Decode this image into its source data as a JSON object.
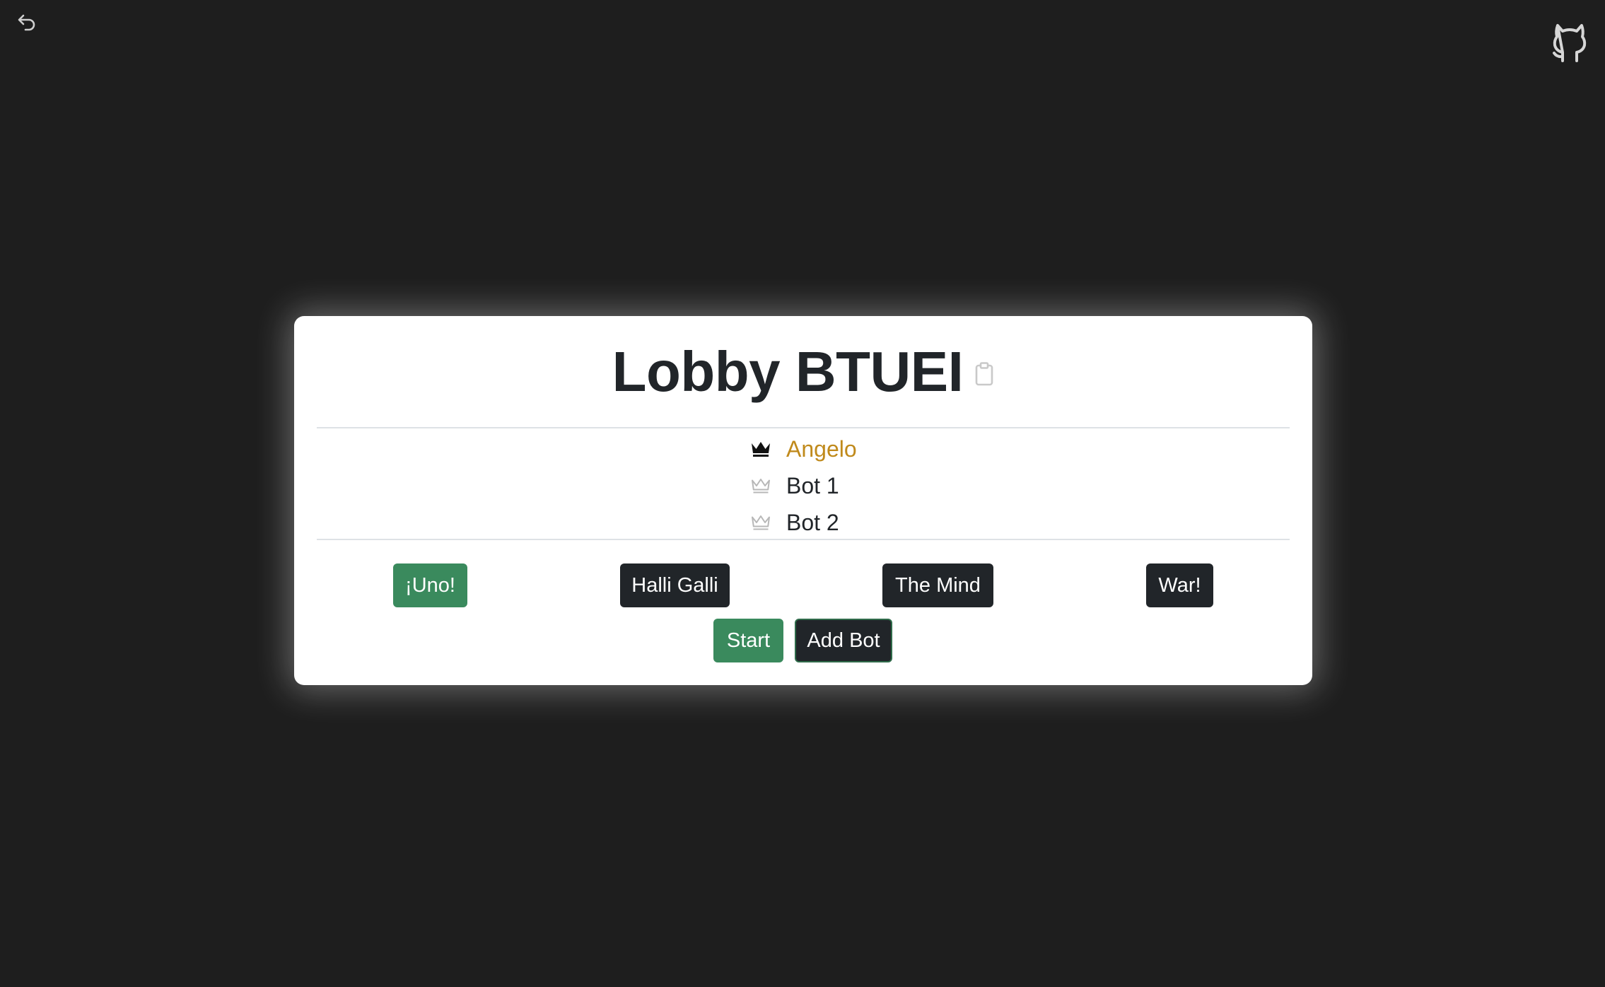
{
  "nav": {
    "back_icon": "undo-arrow-icon",
    "github_icon": "github-octocat-icon"
  },
  "lobby": {
    "title": "Lobby BTUEI",
    "copy_icon": "clipboard-icon"
  },
  "players": [
    {
      "name": "Angelo",
      "host": true,
      "icon": "crown-filled-icon"
    },
    {
      "name": "Bot 1",
      "host": false,
      "icon": "crown-outline-icon"
    },
    {
      "name": "Bot 2",
      "host": false,
      "icon": "crown-outline-icon"
    }
  ],
  "games": [
    {
      "label": "¡Uno!",
      "selected": true
    },
    {
      "label": "Halli Galli",
      "selected": false
    },
    {
      "label": "The Mind",
      "selected": false
    },
    {
      "label": "War!",
      "selected": false
    }
  ],
  "actions": {
    "start_label": "Start",
    "add_bot_label": "Add Bot"
  },
  "colors": {
    "background": "#1e1e1e",
    "card": "#ffffff",
    "host_name": "#c08a1c",
    "selected_green": "#3a8a5d",
    "dark_button": "#212529"
  }
}
